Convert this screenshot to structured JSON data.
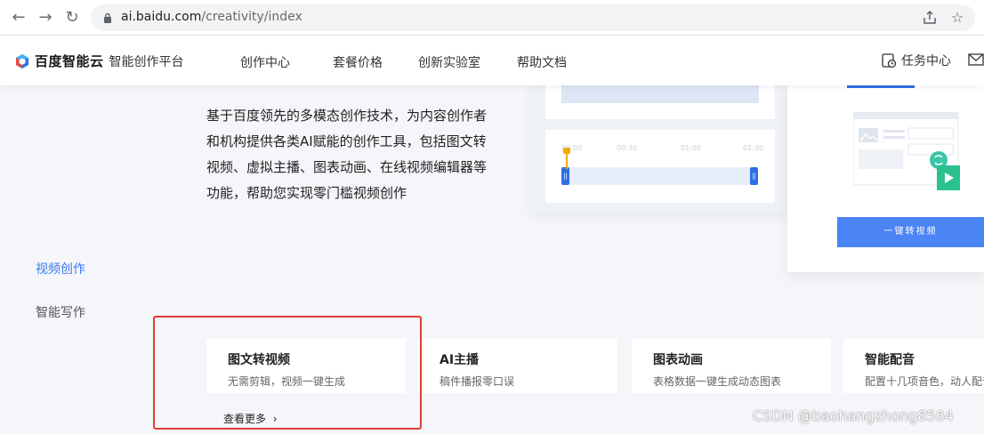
{
  "browser": {
    "url_domain": "ai.baidu.com",
    "url_path": "/creativity/index"
  },
  "header": {
    "brand": "百度智能云",
    "product": "智能创作平台",
    "nav": [
      "创作中心",
      "套餐价格",
      "创新实验室",
      "帮助文档"
    ],
    "task_center": "任务中心"
  },
  "intro": {
    "lines": [
      "基于百度领先的多模态创作技术，为内容创作者",
      "和机构提供各类AI赋能的创作工具，包括图文转",
      "视频、虚拟主播、图表动画、在线视频编辑器等",
      "功能，帮助您实现零门槛视频创作"
    ]
  },
  "preview": {
    "timeline_ticks": [
      "00:00",
      "00:30",
      "01:00",
      "01:30"
    ],
    "cta_label": "一键转视频"
  },
  "sidebar": {
    "items": [
      {
        "label": "视频创作",
        "active": true
      },
      {
        "label": "智能写作",
        "active": false
      }
    ]
  },
  "features": [
    {
      "title": "图文转视频",
      "desc": "无需剪辑，视频一键生成"
    },
    {
      "title": "AI主播",
      "desc": "稿件播报零口误"
    },
    {
      "title": "图表动画",
      "desc": "表格数据一键生成动态图表"
    },
    {
      "title": "智能配音",
      "desc": "配置十几项音色，动人配音"
    }
  ],
  "see_more": "查看更多",
  "watermark": "CSDN @baohangzhong8564",
  "colors": {
    "accent": "#3a7bf4",
    "highlight_border": "#e03c36",
    "cta": "#4b84f5"
  }
}
